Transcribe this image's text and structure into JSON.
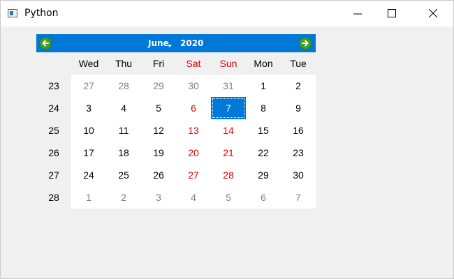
{
  "window": {
    "title": "Python",
    "controls": [
      "minimize",
      "maximize",
      "close"
    ]
  },
  "calendar": {
    "month": "June",
    "year": "2020",
    "days_of_week": [
      {
        "label": "Wed",
        "weekend": false
      },
      {
        "label": "Thu",
        "weekend": false
      },
      {
        "label": "Fri",
        "weekend": false
      },
      {
        "label": "Sat",
        "weekend": true
      },
      {
        "label": "Sun",
        "weekend": true
      },
      {
        "label": "Mon",
        "weekend": false
      },
      {
        "label": "Tue",
        "weekend": false
      }
    ],
    "weeks": [
      {
        "week": "23",
        "days": [
          {
            "d": "27",
            "dim": true
          },
          {
            "d": "28",
            "dim": true
          },
          {
            "d": "29",
            "dim": true
          },
          {
            "d": "30",
            "dim": true
          },
          {
            "d": "31",
            "dim": true
          },
          {
            "d": "1"
          },
          {
            "d": "2"
          }
        ]
      },
      {
        "week": "24",
        "days": [
          {
            "d": "3"
          },
          {
            "d": "4"
          },
          {
            "d": "5"
          },
          {
            "d": "6",
            "weekend": true
          },
          {
            "d": "7",
            "weekend": true,
            "selected": true
          },
          {
            "d": "8"
          },
          {
            "d": "9"
          }
        ]
      },
      {
        "week": "25",
        "days": [
          {
            "d": "10"
          },
          {
            "d": "11"
          },
          {
            "d": "12"
          },
          {
            "d": "13",
            "weekend": true
          },
          {
            "d": "14",
            "weekend": true
          },
          {
            "d": "15"
          },
          {
            "d": "16"
          }
        ]
      },
      {
        "week": "26",
        "days": [
          {
            "d": "17"
          },
          {
            "d": "18"
          },
          {
            "d": "19"
          },
          {
            "d": "20",
            "weekend": true
          },
          {
            "d": "21",
            "weekend": true
          },
          {
            "d": "22"
          },
          {
            "d": "23"
          }
        ]
      },
      {
        "week": "27",
        "days": [
          {
            "d": "24"
          },
          {
            "d": "25"
          },
          {
            "d": "26"
          },
          {
            "d": "27",
            "weekend": true
          },
          {
            "d": "28",
            "weekend": true
          },
          {
            "d": "29"
          },
          {
            "d": "30"
          }
        ]
      },
      {
        "week": "28",
        "days": [
          {
            "d": "1",
            "dim": true
          },
          {
            "d": "2",
            "dim": true
          },
          {
            "d": "3",
            "dim": true
          },
          {
            "d": "4",
            "dim": true
          },
          {
            "d": "5",
            "dim": true
          },
          {
            "d": "6",
            "dim": true
          },
          {
            "d": "7",
            "dim": true
          }
        ]
      }
    ]
  },
  "colors": {
    "nav_bar": "#0078d7",
    "selected": "#0078d7",
    "weekend": "#e00000",
    "dim": "#808080",
    "nav_arrow": "#3f9f2f"
  },
  "icons": {
    "app": "python-window-icon",
    "prev": "arrow-left-circle-icon",
    "next": "arrow-right-circle-icon"
  }
}
